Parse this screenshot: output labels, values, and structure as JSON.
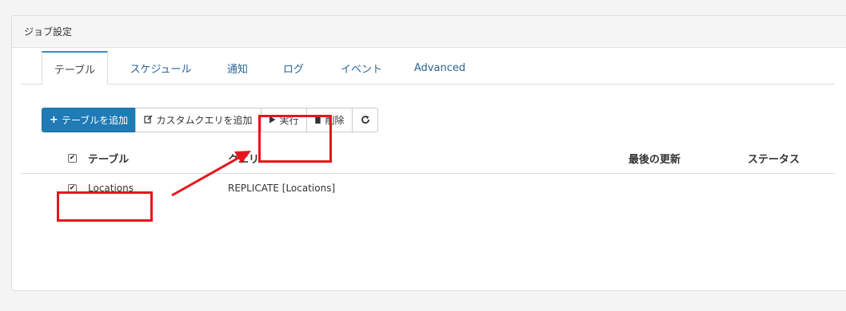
{
  "panel": {
    "title": "ジョブ設定"
  },
  "tabs": [
    {
      "label": "テーブル",
      "active": true
    },
    {
      "label": "スケジュール",
      "active": false
    },
    {
      "label": "通知",
      "active": false
    },
    {
      "label": "ログ",
      "active": false
    },
    {
      "label": "イベント",
      "active": false
    },
    {
      "label": "Advanced",
      "active": false
    }
  ],
  "toolbar": {
    "add_table": "テーブルを追加",
    "add_custom_query": "カスタムクエリを追加",
    "run": "実行",
    "delete": "削除",
    "add_icon": "plus-icon",
    "edit_icon": "edit-icon",
    "run_icon": "play-icon",
    "delete_icon": "trash-icon",
    "refresh_icon": "refresh-icon",
    "primary_color": "#1f7ab5"
  },
  "table": {
    "headers": {
      "table": "テーブル",
      "query": "クエリ",
      "last_updated": "最後の更新",
      "status": "ステータス"
    },
    "rows": [
      {
        "checked": true,
        "table": "Locations",
        "query": "REPLICATE [Locations]",
        "last_updated": "",
        "status": ""
      }
    ]
  },
  "annotation_color": "#e8141c"
}
